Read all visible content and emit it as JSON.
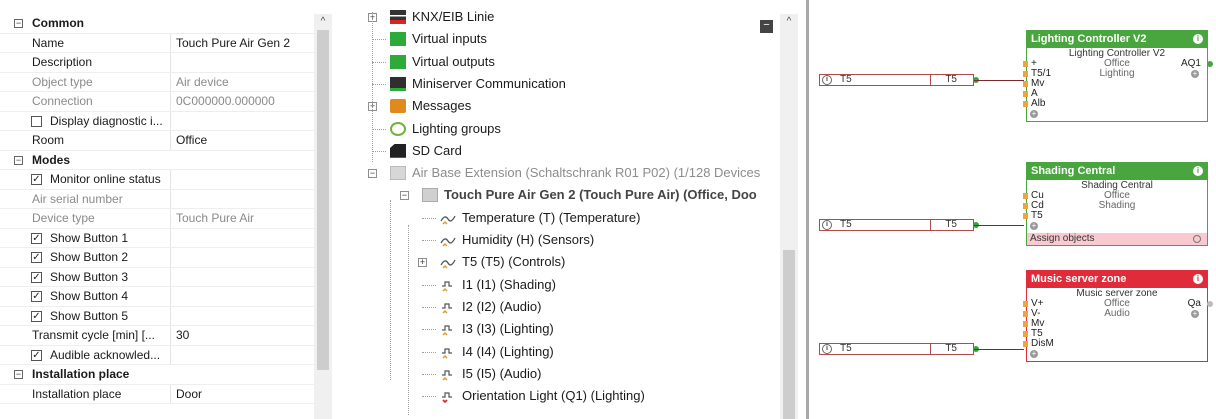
{
  "properties": {
    "rows": [
      {
        "type": "cat",
        "name": "Common",
        "expander": "⊟"
      },
      {
        "type": "prop",
        "name": "Name",
        "value": "Touch Pure Air Gen 2"
      },
      {
        "type": "prop",
        "name": "Description",
        "value": ""
      },
      {
        "type": "gray",
        "name": "Object type",
        "value": "Air device"
      },
      {
        "type": "gray",
        "name": "Connection",
        "value": "0C000000.000000"
      },
      {
        "type": "chk",
        "name": "Display diagnostic i...",
        "checked": false
      },
      {
        "type": "prop",
        "name": "Room",
        "value": "Office"
      },
      {
        "type": "cat",
        "name": "Modes",
        "expander": "⊟"
      },
      {
        "type": "chk",
        "name": "Monitor online status",
        "checked": true
      },
      {
        "type": "gray",
        "name": "Air serial number",
        "value": ""
      },
      {
        "type": "gray",
        "name": "Device type",
        "value": "Touch Pure Air"
      },
      {
        "type": "chk",
        "name": "Show Button 1",
        "checked": true
      },
      {
        "type": "chk",
        "name": "Show Button 2",
        "checked": true
      },
      {
        "type": "chk",
        "name": "Show Button 3",
        "checked": true
      },
      {
        "type": "chk",
        "name": "Show Button 4",
        "checked": true
      },
      {
        "type": "chk",
        "name": "Show Button 5",
        "checked": true
      },
      {
        "type": "prop",
        "name": "Transmit cycle [min] [...",
        "value": "30"
      },
      {
        "type": "chk",
        "name": "Audible acknowled...",
        "checked": true
      },
      {
        "type": "cat",
        "name": "Installation place",
        "expander": "⊟"
      },
      {
        "type": "prop",
        "name": "Installation place",
        "value": "Door"
      }
    ]
  },
  "tree": {
    "nodes": [
      {
        "label": "KNX/EIB Linie",
        "icon": "knx-icon",
        "level": 0,
        "expander": "⊞",
        "style": ""
      },
      {
        "label": "Virtual inputs",
        "icon": "virtual-input-icon",
        "level": 0,
        "expander": "",
        "style": ""
      },
      {
        "label": "Virtual outputs",
        "icon": "virtual-output-icon",
        "level": 0,
        "expander": "",
        "style": ""
      },
      {
        "label": "Miniserver Communication",
        "icon": "miniserver-icon",
        "level": 0,
        "expander": "",
        "style": ""
      },
      {
        "label": "Messages",
        "icon": "messages-icon",
        "level": 0,
        "expander": "⊞",
        "style": ""
      },
      {
        "label": "Lighting groups",
        "icon": "lighting-groups-icon",
        "level": 0,
        "expander": "",
        "style": ""
      },
      {
        "label": "SD Card",
        "icon": "sd-card-icon",
        "level": 0,
        "expander": "",
        "style": ""
      },
      {
        "label": "Air Base Extension (Schaltschrank R01 P02) (1/128 Devices",
        "icon": "air-base-icon",
        "level": 0,
        "expander": "⊟",
        "style": "gray"
      },
      {
        "label": "Touch Pure Air Gen 2 (Touch Pure Air) (Office, Doo",
        "icon": "touch-pure-icon",
        "level": 1,
        "expander": "⊟",
        "style": "bold"
      },
      {
        "label": "Temperature (T) (Temperature)",
        "icon": "analog-input-icon",
        "level": 2,
        "expander": "",
        "style": ""
      },
      {
        "label": "Humidity (H) (Sensors)",
        "icon": "analog-input-icon",
        "level": 2,
        "expander": "",
        "style": ""
      },
      {
        "label": "T5 (T5) (Controls)",
        "icon": "analog-input-icon",
        "level": 2,
        "expander": "⊞",
        "style": ""
      },
      {
        "label": "I1 (I1) (Shading)",
        "icon": "digital-input-icon",
        "level": 2,
        "expander": "",
        "style": ""
      },
      {
        "label": "I2 (I2) (Audio)",
        "icon": "digital-input-icon",
        "level": 2,
        "expander": "",
        "style": ""
      },
      {
        "label": "I3 (I3) (Lighting)",
        "icon": "digital-input-icon",
        "level": 2,
        "expander": "",
        "style": ""
      },
      {
        "label": "I4 (I4) (Lighting)",
        "icon": "digital-input-icon",
        "level": 2,
        "expander": "",
        "style": ""
      },
      {
        "label": "I5 (I5) (Audio)",
        "icon": "digital-input-icon",
        "level": 2,
        "expander": "",
        "style": ""
      },
      {
        "label": "Orientation Light (Q1) (Lighting)",
        "icon": "digital-output-icon",
        "level": 2,
        "expander": "",
        "style": ""
      }
    ]
  },
  "canvas": {
    "refs": [
      {
        "left": "T5",
        "right": "T5"
      },
      {
        "left": "T5",
        "right": "T5"
      },
      {
        "left": "T5",
        "right": "T5"
      }
    ],
    "blocks": [
      {
        "title": "Lighting Controller V2",
        "subtitle": "Lighting Controller V2",
        "mid1": "Office",
        "mid2": "Lighting",
        "inputs": [
          "+",
          "T5/1",
          "Mv",
          "A",
          "Alb"
        ],
        "output": "AQ1"
      },
      {
        "title": "Shading Central",
        "subtitle": "Shading Central",
        "mid1": "Office",
        "mid2": "Shading",
        "inputs": [
          "Cu",
          "Cd",
          "T5"
        ],
        "assign": "Assign objects"
      },
      {
        "title": "Music server zone",
        "subtitle": "Music server zone",
        "mid1": "Office",
        "mid2": "Audio",
        "inputs": [
          "V+",
          "V-",
          "Mv",
          "T5",
          "DisM"
        ],
        "output": "Qa"
      }
    ]
  }
}
